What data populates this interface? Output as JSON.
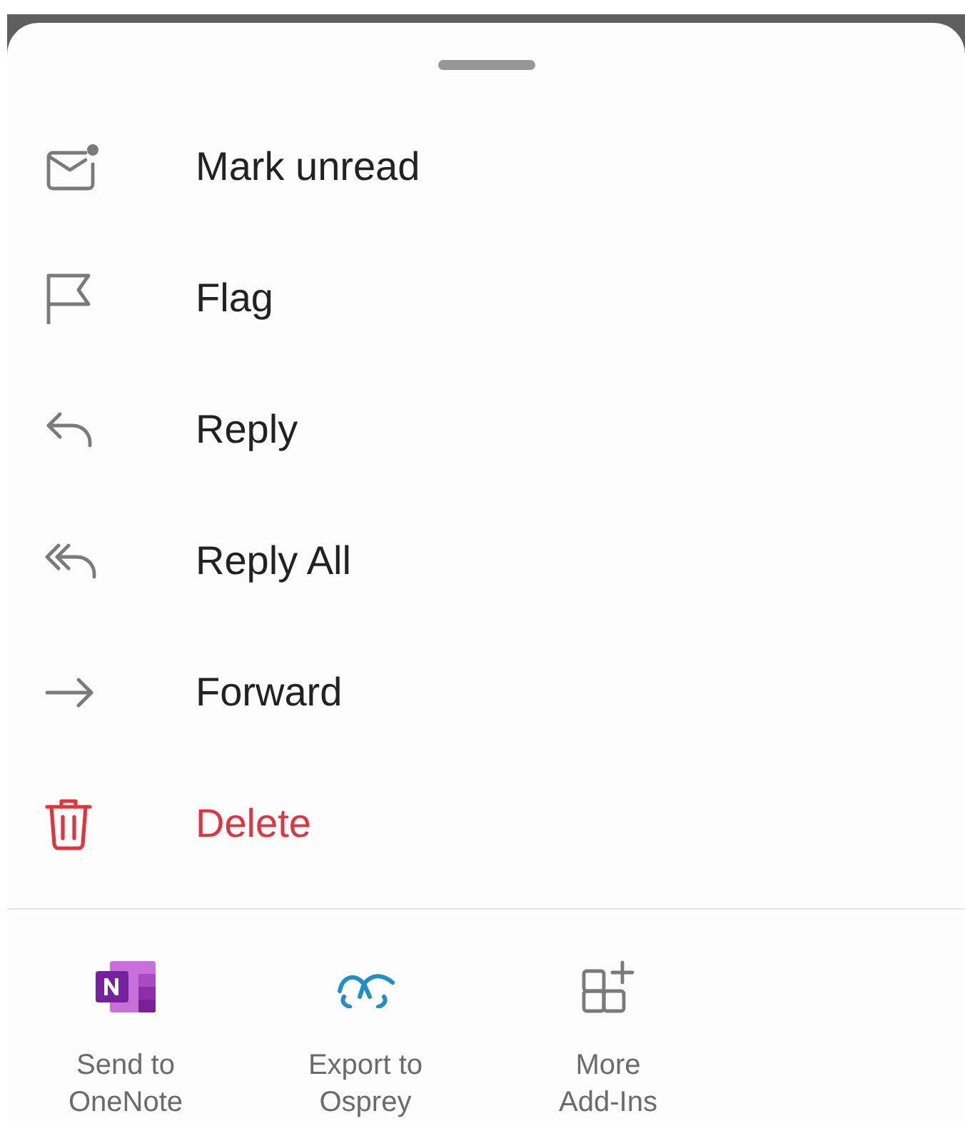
{
  "actions": [
    {
      "kind": "mark_unread",
      "label": "Mark unread",
      "danger": false
    },
    {
      "kind": "flag",
      "label": "Flag",
      "danger": false
    },
    {
      "kind": "reply",
      "label": "Reply",
      "danger": false
    },
    {
      "kind": "reply_all",
      "label": "Reply All",
      "danger": false
    },
    {
      "kind": "forward",
      "label": "Forward",
      "danger": false
    },
    {
      "kind": "delete",
      "label": "Delete",
      "danger": true
    }
  ],
  "add_ins": [
    {
      "kind": "onenote",
      "label_lines": [
        "Send to",
        "OneNote"
      ]
    },
    {
      "kind": "osprey",
      "label_lines": [
        "Export to",
        "Osprey"
      ]
    },
    {
      "kind": "more",
      "label_lines": [
        "More",
        "Add-Ins"
      ]
    }
  ]
}
